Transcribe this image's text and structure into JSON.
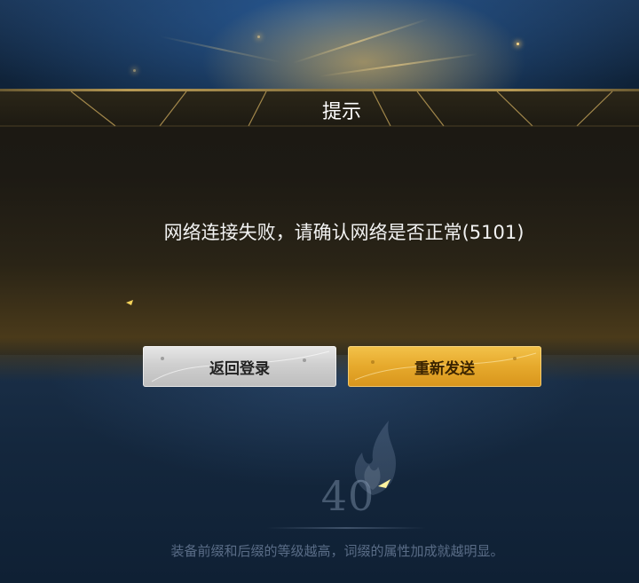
{
  "dialog": {
    "title": "提示",
    "message": "网络连接失败，请确认网络是否正常(5101)",
    "buttons": {
      "back_login_label": "返回登录",
      "resend_label": "重新发送"
    }
  },
  "background": {
    "level_number": "40",
    "tip_text": "装备前缀和后缀的等级越高，词缀的属性加成就越明显。"
  },
  "colors": {
    "accent_gold": "#e6a92c",
    "secondary_silver": "#cfcfcf",
    "dialog_bg": "#1d1a14",
    "background_blue": "#0f2238"
  },
  "icons": {
    "flame": "flame-icon",
    "sparkle": "sparkle-icon"
  }
}
